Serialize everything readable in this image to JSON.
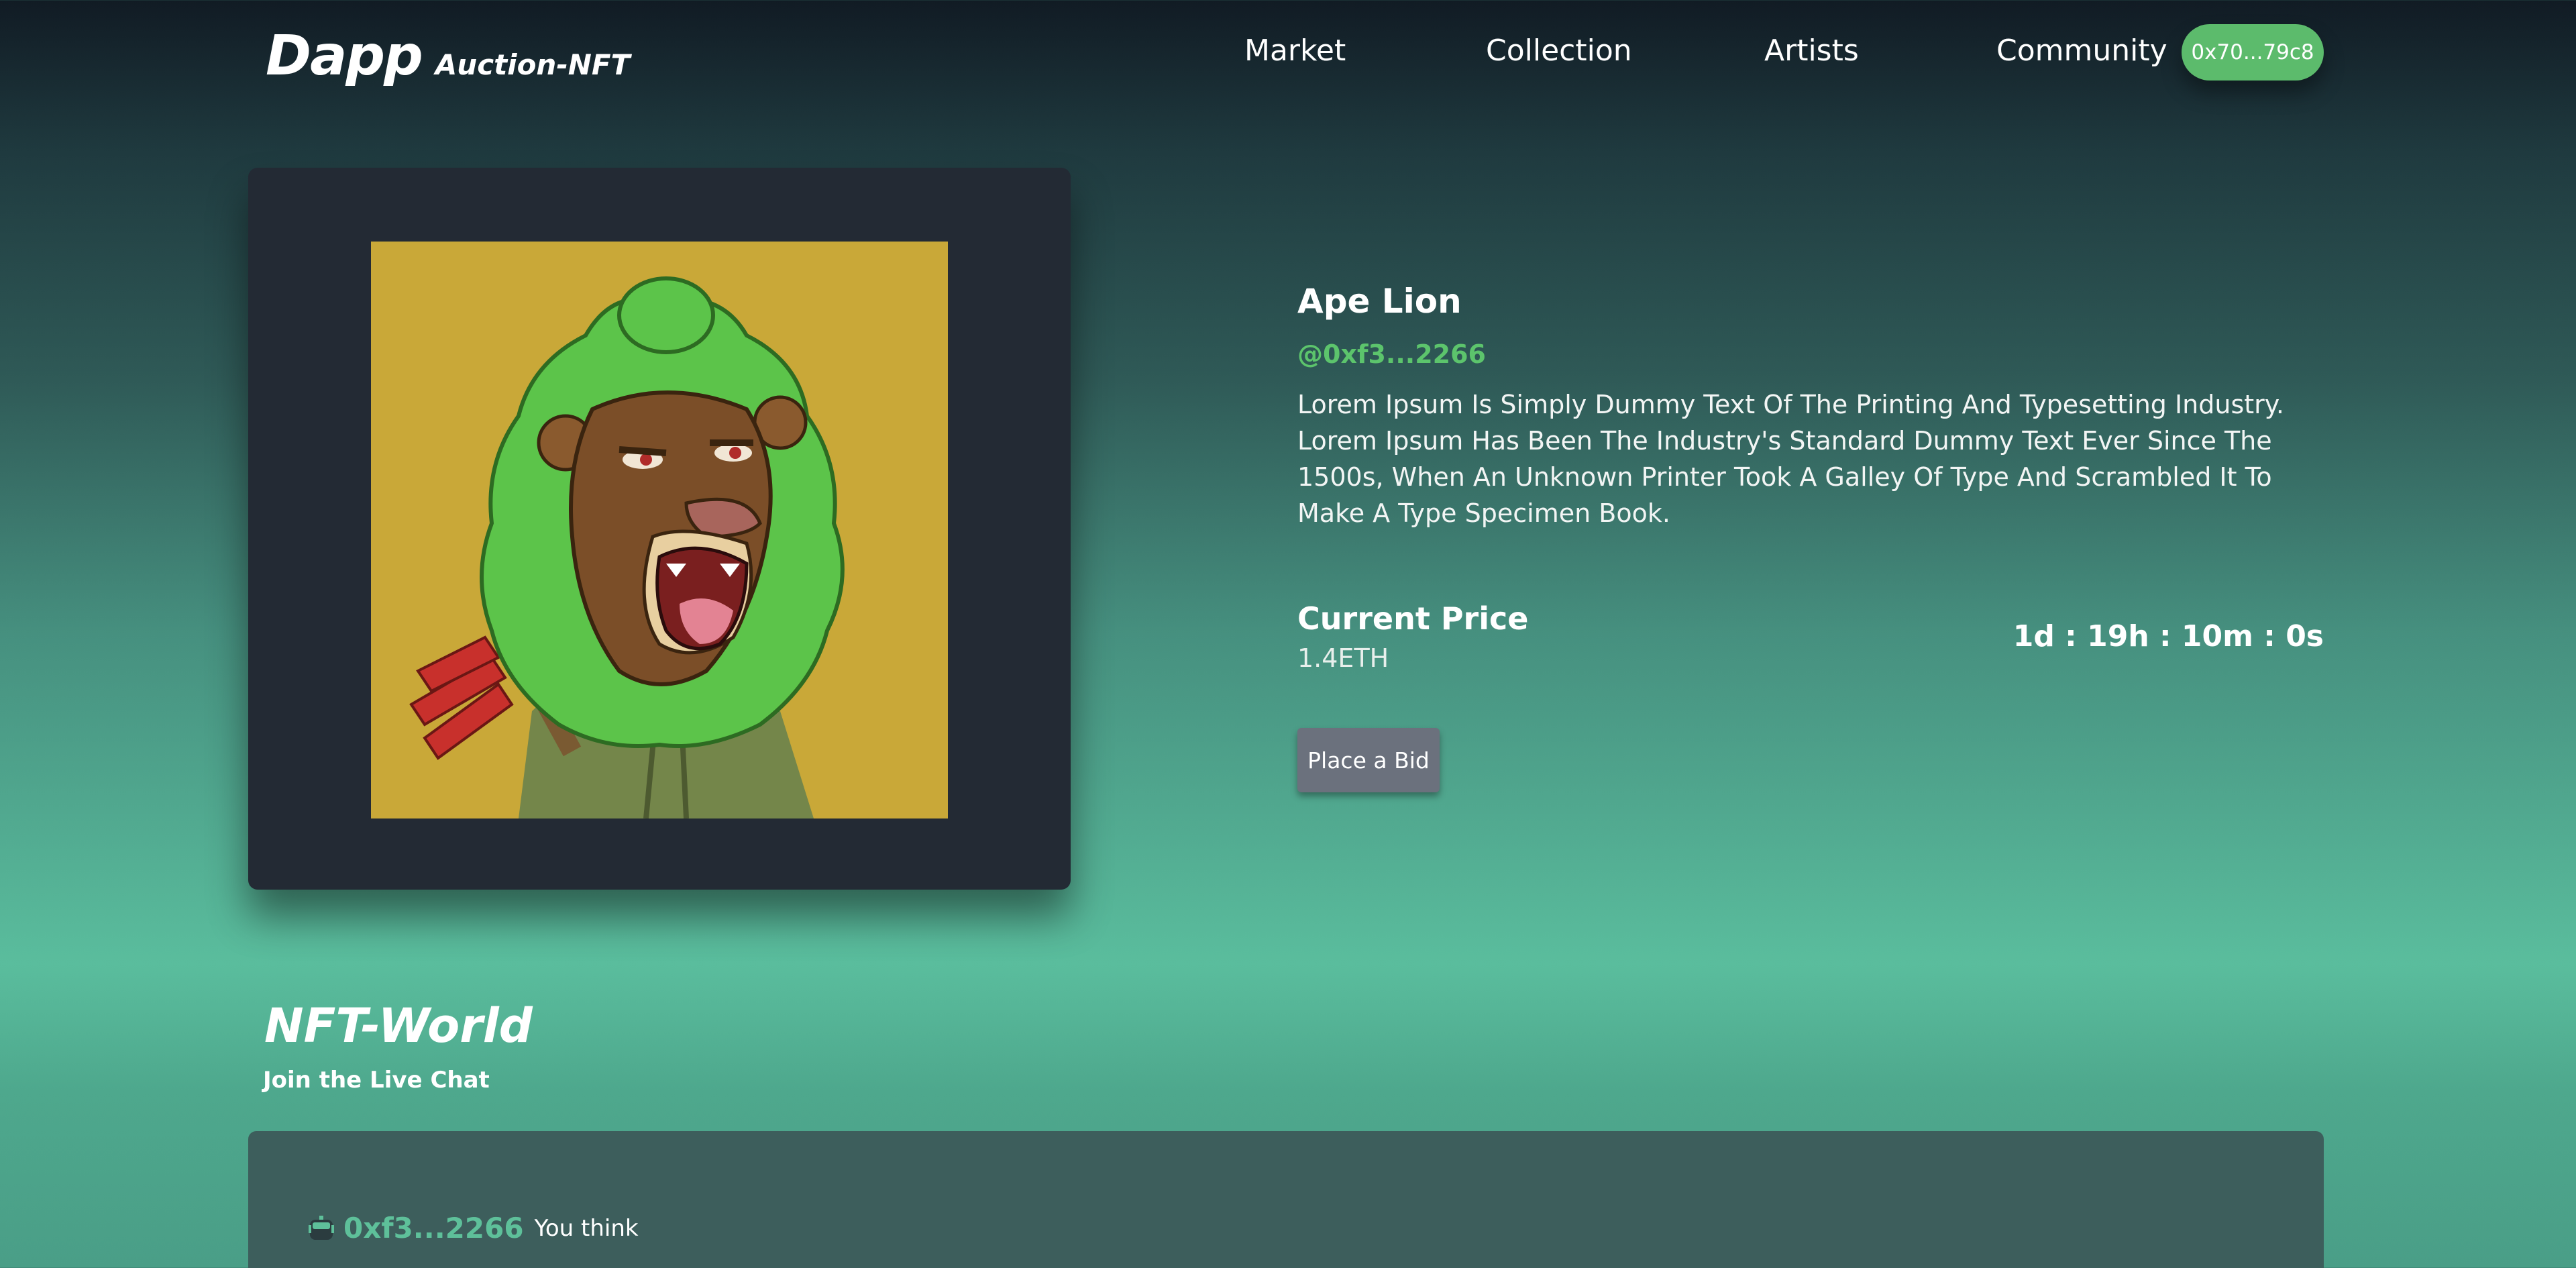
{
  "brand": {
    "logo": "Dapp",
    "subtitle": "Auction-NFT"
  },
  "nav": {
    "links": [
      "Market",
      "Collection",
      "Artists",
      "Community"
    ],
    "wallet": "0x70...79c8"
  },
  "nft": {
    "title": "Ape Lion",
    "owner": "@0xf3...2266",
    "description": "Lorem Ipsum Is Simply Dummy Text Of The Printing And Typesetting Industry. Lorem Ipsum Has Been The Industry's Standard Dummy Text Ever Since The 1500s, When An Unknown Printer Took A Galley Of Type And Scrambled It To Make A Type Specimen Book.",
    "price_label": "Current Price",
    "price_value": "1.4ETH",
    "countdown": "1d : 19h : 10m : 0s",
    "bid_label": "Place a Bid"
  },
  "chat": {
    "title": "NFT-World",
    "subtitle": "Join the Live Chat",
    "messages": [
      {
        "user": "0xf3...2266",
        "text": "You think"
      }
    ]
  },
  "colors": {
    "accent_green": "#5cbb6c",
    "card_bg": "#232a34",
    "bid_button": "#6b717d",
    "chat_panel": "#3d5e5c",
    "image_bg": "#c9a838"
  }
}
